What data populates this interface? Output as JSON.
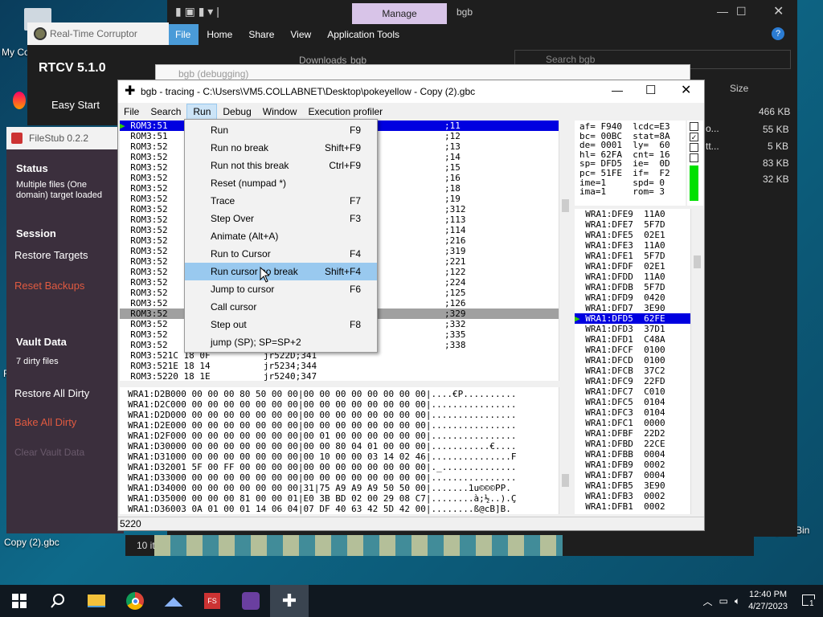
{
  "desktop": {
    "icons": [
      {
        "label": "My Co"
      },
      {
        "label": "Copy (2).gbc"
      },
      {
        "label": "Recycle Bin"
      },
      {
        "label": "F"
      }
    ]
  },
  "explorer": {
    "tab_manage": "Manage",
    "title": "bgb",
    "tabs": [
      "File",
      "Home",
      "Share",
      "View",
      "Application Tools"
    ],
    "path_a": "Downloads",
    "path_b": "bgb",
    "search_placeholder": "Search bgb",
    "size_header": "Size",
    "sizes": [
      "466 KB",
      "55 KB",
      "5 KB",
      "83 KB",
      "32 KB"
    ],
    "name_frags": [
      "o...",
      "tt..."
    ],
    "status": "10 it"
  },
  "rtcv": {
    "title": "Real-Time Corruptor",
    "version": "RTCV 5.1.0",
    "easy_start": "Easy Start"
  },
  "filestub": {
    "title": "FileStub 0.2.2",
    "status_h": "Status",
    "status_text": "Multiple files (One domain) target loaded",
    "session_h": "Session",
    "restore_targets": "Restore Targets",
    "reset_backups": "Reset Backups",
    "vault_h": "Vault Data",
    "dirty": "7 dirty files",
    "restore_dirty": "Restore All Dirty",
    "bake_dirty": "Bake All Dirty",
    "clear_vault": "Clear Vault Data"
  },
  "bgb_debug_title": "bgb (debugging)",
  "bgb": {
    "title": "bgb - tracing - C:\\Users\\VM5.COLLABNET\\Desktop\\pokeyellow - Copy (2).gbc",
    "menus": [
      "File",
      "Search",
      "Run",
      "Debug",
      "Window",
      "Execution profiler"
    ],
    "disasm": [
      {
        "a": "ROM3:51",
        "c": ";1",
        "n": "1"
      },
      {
        "a": "ROM3:51",
        "c": ";1",
        "n": "2"
      },
      {
        "a": "ROM3:52",
        "c": ";1",
        "n": "3"
      },
      {
        "a": "ROM3:52",
        "c": ";1",
        "n": "4"
      },
      {
        "a": "ROM3:52",
        "c": ";1",
        "n": "5"
      },
      {
        "a": "ROM3:52",
        "c": ";1",
        "n": "6"
      },
      {
        "a": "ROM3:52",
        "c": ";1",
        "n": "8"
      },
      {
        "a": "ROM3:52",
        "c": ";1",
        "n": "9"
      },
      {
        "a": "ROM3:52",
        "c": ";3",
        "n": "12"
      },
      {
        "a": "ROM3:52",
        "c": ";1",
        "n": "13"
      },
      {
        "a": "ROM3:52",
        "c": ";1",
        "n": "14"
      },
      {
        "a": "ROM3:52",
        "c": ";2",
        "n": "16"
      },
      {
        "a": "ROM3:52",
        "c": ";3",
        "n": "19"
      },
      {
        "a": "ROM3:52",
        "c": ";2",
        "n": "21"
      },
      {
        "a": "ROM3:52",
        "c": ";1",
        "n": "22"
      },
      {
        "a": "ROM3:52",
        "c": ";2",
        "n": "24"
      },
      {
        "a": "ROM3:52",
        "c": ";1",
        "n": "25"
      },
      {
        "a": "ROM3:52",
        "c": ";1",
        "n": "26"
      },
      {
        "a": "ROM3:52",
        "c": ";3",
        "n": "29"
      },
      {
        "a": "ROM3:52",
        "c": ";3",
        "n": "32"
      },
      {
        "a": "ROM3:52",
        "c": ";3",
        "n": "35"
      },
      {
        "a": "ROM3:52",
        "c": ";3",
        "n": "38"
      },
      {
        "a": "ROM3:521C 18 0F",
        "op": "jr",
        "arg": "522D",
        "c": ";3",
        "n": "41"
      },
      {
        "a": "ROM3:521E 18 14",
        "op": "jr",
        "arg": "5234",
        "c": ";3",
        "n": "44"
      },
      {
        "a": "ROM3:5220 18 1E",
        "op": "jr",
        "arg": "5240",
        "c": ";3",
        "n": "47"
      }
    ],
    "regs": [
      "af= F940  lcdc=E3",
      "bc= 00BC  stat=8A",
      "de= 0001  ly=  60",
      "hl= 62FA  cnt= 16",
      "sp= DFD5  ie=  0D",
      "pc= 51FE  if=  F2",
      "ime=1     spd= 0",
      "ima=1     rom= 3"
    ],
    "flags": [
      "z",
      "n",
      "h",
      "c"
    ],
    "stack": [
      "WRA1:DFE9  11A0",
      "WRA1:DFE7  5F7D",
      "WRA1:DFE5  02E1",
      "WRA1:DFE3  11A0",
      "WRA1:DFE1  5F7D",
      "WRA1:DFDF  02E1",
      "WRA1:DFDD  11A0",
      "WRA1:DFDB  5F7D",
      "WRA1:DFD9  0420",
      "WRA1:DFD7  3E90",
      "WRA1:DFD5  62FE",
      "WRA1:DFD3  37D1",
      "WRA1:DFD1  C48A",
      "WRA1:DFCF  0100",
      "WRA1:DFCD  0100",
      "WRA1:DFCB  37C2",
      "WRA1:DFC9  22FD",
      "WRA1:DFC7  C010",
      "WRA1:DFC5  0104",
      "WRA1:DFC3  0104",
      "WRA1:DFC1  0000",
      "WRA1:DFBF  22D2",
      "WRA1:DFBD  22CE",
      "WRA1:DFBB  0004",
      "WRA1:DFB9  0002",
      "WRA1:DFB7  0004",
      "WRA1:DFB5  3E90",
      "WRA1:DFB3  0002",
      "WRA1:DFB1  0002"
    ],
    "mem": [
      {
        "a": "WRA1:D2B0",
        "h": "00 00 00 00 80 50 00 00|00 00 00 00 00 00 00 00|",
        "t": "....€P.........."
      },
      {
        "a": "WRA1:D2C0",
        "h": "00 00 00 00 00 00 00 00|00 00 00 00 00 00 00 00|",
        "t": "................"
      },
      {
        "a": "WRA1:D2D0",
        "h": "00 00 00 00 00 00 00 00|00 00 00 00 00 00 00 00|",
        "t": "................"
      },
      {
        "a": "WRA1:D2E0",
        "h": "00 00 00 00 00 00 00 00|00 00 00 00 00 00 00 00|",
        "t": "................"
      },
      {
        "a": "WRA1:D2F0",
        "h": "00 00 00 00 00 00 00 00|00 01 00 00 00 00 00 00|",
        "t": "................"
      },
      {
        "a": "WRA1:D300",
        "h": "00 00 00 00 00 00 00 00|00 00 80 04 01 00 00 00|",
        "t": "...........€...."
      },
      {
        "a": "WRA1:D310",
        "h": "00 00 00 00 00 00 00 00|00 10 00 00 03 14 02 46|",
        "t": "...............F"
      },
      {
        "a": "WRA1:D320",
        "h": "01 5F 00 FF 00 00 00 00|00 00 00 00 00 00 00 00|",
        "t": "._.............."
      },
      {
        "a": "WRA1:D330",
        "h": "00 00 00 00 00 00 00 00|00 00 00 00 00 00 00 00|",
        "t": "................"
      },
      {
        "a": "WRA1:D340",
        "h": "00 00 00 00 00 00 00 00|31|75 A9 A9 A9 50 50 00|",
        "t": ".......1u©©©PP."
      },
      {
        "a": "WRA1:D350",
        "h": "00 00 00 00 81 00 00 01|E0 3B BD 02 00 29 08 C7|",
        "t": "........à;½..).Ç"
      },
      {
        "a": "WRA1:D360",
        "h": "03 0A 01 00 01 14 06 04|07 DF 40 63 42 5D 42 00|",
        "t": "........ß@cB]B."
      }
    ],
    "status": "5220"
  },
  "runmenu": [
    {
      "label": "Run",
      "key": "F9"
    },
    {
      "label": "Run no break",
      "key": "Shift+F9"
    },
    {
      "label": "Run not this break",
      "key": "Ctrl+F9"
    },
    {
      "label": "Reset (numpad *)",
      "key": ""
    },
    {
      "label": "Trace",
      "key": "F7"
    },
    {
      "label": "Step Over",
      "key": "F3"
    },
    {
      "label": "Animate (Alt+A)",
      "key": ""
    },
    {
      "label": "Run to Cursor",
      "key": "F4"
    },
    {
      "label": "Run cursor no break",
      "key": "Shift+F4"
    },
    {
      "label": "Jump to cursor",
      "key": "F6"
    },
    {
      "label": "Call cursor",
      "key": ""
    },
    {
      "label": "Step out",
      "key": "F8"
    },
    {
      "label": "jump (SP); SP=SP+2",
      "key": ""
    }
  ],
  "clock": {
    "time": "12:40 PM",
    "date": "4/27/2023"
  },
  "notif_count": "1"
}
